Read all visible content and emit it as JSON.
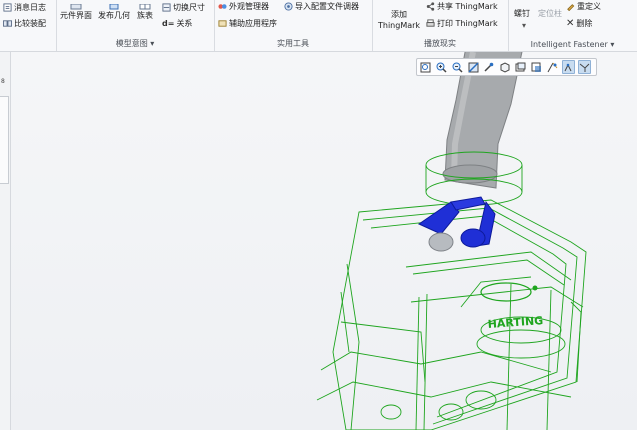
{
  "ribbon": {
    "group0": {
      "items": [
        "消息日志",
        "比较装配"
      ]
    },
    "group1": {
      "items": [
        "元件界面",
        "发布几何",
        "族表",
        "切换尺寸",
        "关系"
      ],
      "label": "模型意图 ▾"
    },
    "group2": {
      "items": [
        "外观管理器",
        "导入配置文件调器",
        "辅助应用程序"
      ],
      "label": "实用工具"
    },
    "group3": {
      "add_line1": "添加",
      "add_line2": "ThingMark",
      "share": "共享 ThingMark",
      "print": "打印 ThingMark",
      "label": "播放现实"
    },
    "group4": {
      "item1": "螺钉",
      "item1_disabled": "定位柱",
      "item2_top": "重定义",
      "item2_delete": "删除",
      "label": "Intelligent Fastener ▾"
    }
  },
  "left_strip": {
    "mark": "8"
  },
  "viewport": {
    "toolbar_icons": [
      "zoom-window-icon",
      "zoom-in-icon",
      "zoom-out-icon",
      "repaint-icon",
      "spin-center-icon",
      "saved-orientations-icon",
      "view-manager-icon",
      "display-style-icon",
      "datum-display-icon",
      "annotation-display-icon",
      "show-hide-icon"
    ],
    "model_label": "HARTING"
  },
  "colors": {
    "wireframe": "#1fa51f",
    "cable": "#a9acaf",
    "clip": "#1f2fd6"
  }
}
